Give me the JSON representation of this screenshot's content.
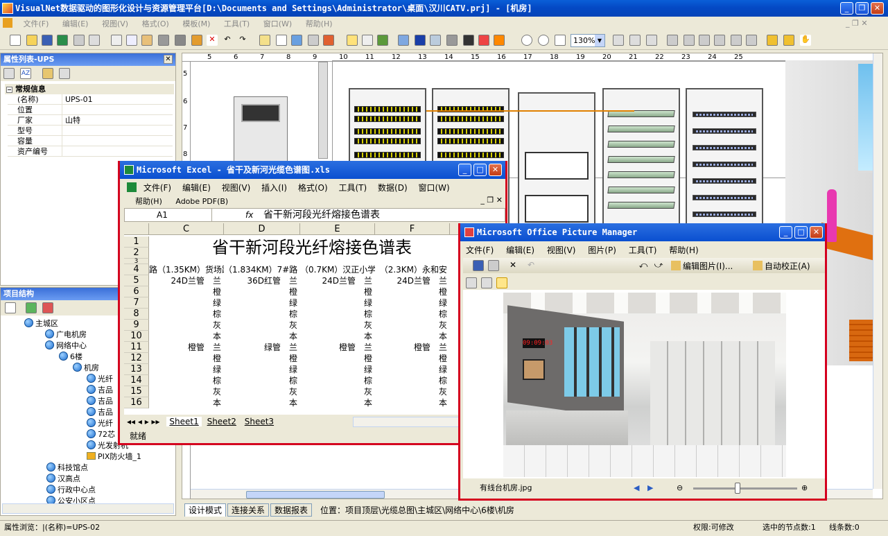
{
  "app": {
    "title": "VisualNet数据驱动的图形化设计与资源管理平台[D:\\Documents and Settings\\Administrator\\桌面\\汉川CATV.prj] - [机房]"
  },
  "menu": [
    "文件(F)",
    "编辑(E)",
    "视图(V)",
    "格式(O)",
    "模板(M)",
    "工具(T)",
    "窗口(W)",
    "帮助(H)"
  ],
  "zoom": "130%",
  "ruler": [
    "5",
    "6",
    "7",
    "8",
    "9",
    "10",
    "11",
    "12",
    "13",
    "14",
    "15",
    "16",
    "17",
    "18",
    "19",
    "20",
    "21",
    "22",
    "23",
    "24",
    "25"
  ],
  "vruler": [
    "5",
    "6",
    "7",
    "8"
  ],
  "props": {
    "title": "属性列表-UPS",
    "section": "常规信息",
    "rows": [
      {
        "k": "(名称)",
        "v": "UPS-01"
      },
      {
        "k": "位置",
        "v": ""
      },
      {
        "k": "厂家",
        "v": "山特"
      },
      {
        "k": "型号",
        "v": ""
      },
      {
        "k": "容量",
        "v": ""
      },
      {
        "k": "资产编号",
        "v": ""
      }
    ]
  },
  "project": {
    "title": "项目结构",
    "items": [
      "主城区",
      "广电机房",
      "网络中心",
      "6楼",
      "机房",
      "光纤",
      "吉品",
      "吉品",
      "吉品",
      "光纤",
      "72芯",
      "光发射机",
      "PIX防火墙_1",
      "科技馆点",
      "汉高点",
      "行政中心点",
      "公安小区点"
    ]
  },
  "excel": {
    "title": "Microsoft Excel - 省干及新河光缆色谱图.xls",
    "menu1": [
      "文件(F)",
      "编辑(E)",
      "视图(V)",
      "插入(I)",
      "格式(O)",
      "工具(T)",
      "数据(D)",
      "窗口(W)"
    ],
    "menu2": [
      "帮助(H)",
      "Adobe PDF(B)"
    ],
    "namebox": "A1",
    "formula": "省干新河段光纤熔接色谱表",
    "cols": [
      "C",
      "D",
      "E",
      "F"
    ],
    "rows": [
      "1",
      "2",
      "3",
      "4",
      "5",
      "6",
      "7",
      "8",
      "9",
      "10",
      "11",
      "12",
      "13",
      "14",
      "15",
      "16"
    ],
    "heading": "省干新河段光纤熔接色谱表",
    "row4": [
      "路（1.35KM）货场路",
      "（1.834KM）7#路",
      "（0.7KM）汉正小学",
      "（2.3KM）永和安"
    ],
    "row5": [
      "24D兰管　兰",
      "36D红管　兰",
      "24D兰管　兰",
      "24D兰管　兰"
    ],
    "row11": [
      "橙管　兰",
      "绿管　兰",
      "橙管　兰",
      "橙管　兰"
    ],
    "colors": [
      "橙",
      "绿",
      "棕",
      "灰",
      "本"
    ],
    "sheets": [
      "Sheet1",
      "Sheet2",
      "Sheet3"
    ],
    "status": "就绪"
  },
  "picmgr": {
    "title": "Microsoft Office Picture Manager",
    "menu": [
      "文件(F)",
      "编辑(E)",
      "视图(V)",
      "图片(P)",
      "工具(T)",
      "帮助(H)"
    ],
    "edit_btn": "编辑图片(I)...",
    "auto_btn": "自动校正(A)",
    "filename": "有线台机房.jpg",
    "clock": "09:09:03"
  },
  "tabs": [
    "设计模式",
    "连接关系",
    "数据报表"
  ],
  "location": "位置：项目顶层\\光缆总图\\主城区\\网络中心\\6楼\\机房",
  "status": {
    "left": "属性浏览：|(名称)=UPS-02",
    "perm": "权限:可修改",
    "nodes": "选中的节点数:1",
    "lines": "线条数:0"
  }
}
